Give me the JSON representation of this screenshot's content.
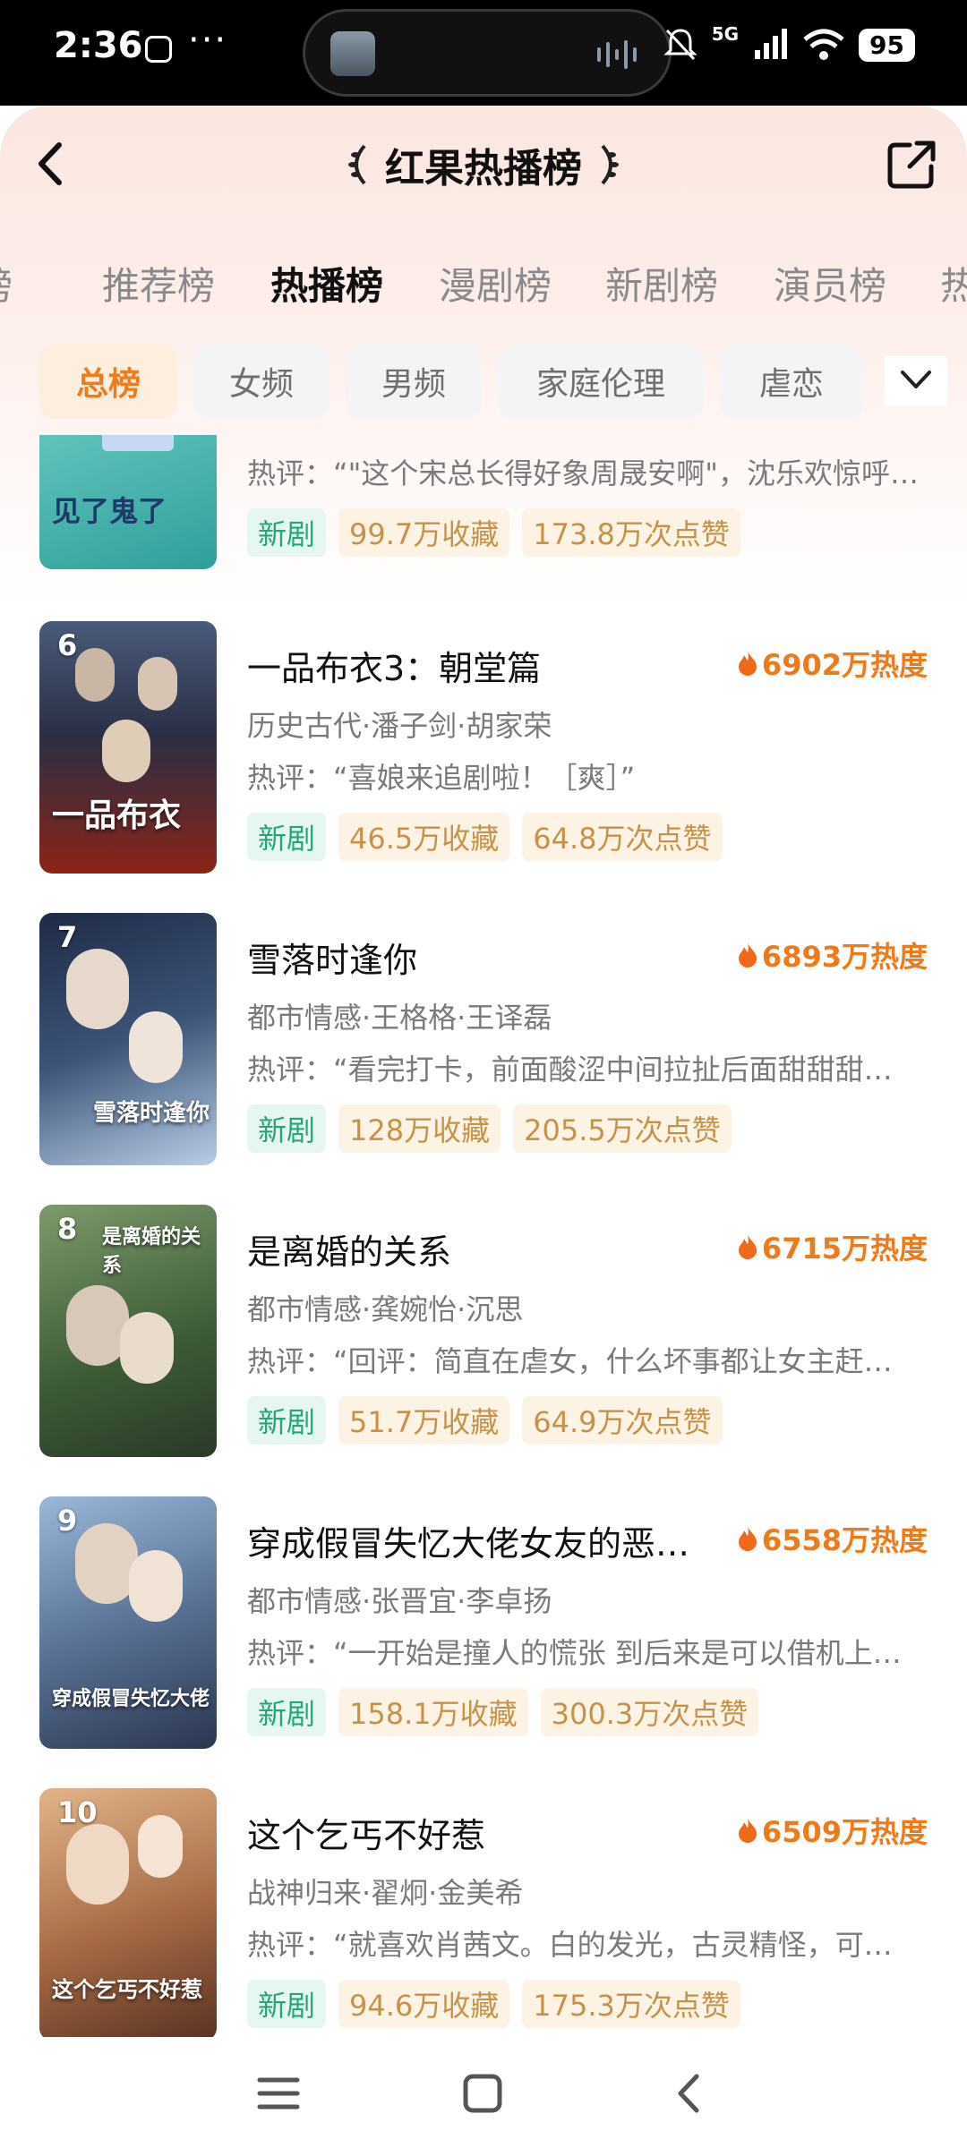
{
  "status_bar": {
    "time": "2:36",
    "more": "···",
    "network": "5G",
    "battery": "95"
  },
  "header": {
    "title": "红果热播榜"
  },
  "tabs": [
    {
      "label": "榜"
    },
    {
      "label": "推荐榜"
    },
    {
      "label": "热播榜"
    },
    {
      "label": "漫剧榜"
    },
    {
      "label": "新剧榜"
    },
    {
      "label": "演员榜"
    },
    {
      "label": "热"
    }
  ],
  "chips": [
    {
      "label": "总榜"
    },
    {
      "label": "女频"
    },
    {
      "label": "男频"
    },
    {
      "label": "家庭伦理"
    },
    {
      "label": "虐恋"
    }
  ],
  "items": [
    {
      "rank": "",
      "name": "",
      "heat": "",
      "meta": "",
      "review": "热评：“\"这个宋总长得好象周晟安啊\"，沈乐欢惊呼…",
      "tag_new": "新剧",
      "favorites": "99.7万收藏",
      "likes": "173.8万次点赞",
      "poster_text": "见了鬼了",
      "poster_colors": [
        "#5fc9c0",
        "#2e9f9a"
      ]
    },
    {
      "rank": "6",
      "name": "一品布衣3：朝堂篇",
      "heat": "6902万热度",
      "meta": "历史古代·潘子剑·胡家荣",
      "review": "热评：“喜娘来追剧啦！［爽］”",
      "tag_new": "新剧",
      "favorites": "46.5万收藏",
      "likes": "64.8万次点赞",
      "poster_text": "一品布衣",
      "poster_colors": [
        "#3a4a6a",
        "#8a2a1e"
      ]
    },
    {
      "rank": "7",
      "name": "雪落时逢你",
      "heat": "6893万热度",
      "meta": "都市情感·王格格·王译磊",
      "review": "热评：“看完打卡，前面酸涩中间拉扯后面甜甜甜…",
      "tag_new": "新剧",
      "favorites": "128万收藏",
      "likes": "205.5万次点赞",
      "poster_text": "雪落时逢你",
      "poster_colors": [
        "#2b3a5c",
        "#a9c2e0"
      ]
    },
    {
      "rank": "8",
      "name": "是离婚的关系",
      "heat": "6715万热度",
      "meta": "都市情感·龚婉怡·沉思",
      "review": "热评：“回评：简直在虐女，什么坏事都让女主赶…",
      "tag_new": "新剧",
      "favorites": "51.7万收藏",
      "likes": "64.9万次点赞",
      "poster_text": "是离婚的关系",
      "poster_colors": [
        "#3f5a3a",
        "#8fa67c"
      ]
    },
    {
      "rank": "9",
      "name": "穿成假冒失忆大佬女友的恶…",
      "heat": "6558万热度",
      "meta": "都市情感·张晋宜·李卓扬",
      "review": "热评：“一开始是撞人的慌张 到后来是可以借机上…",
      "tag_new": "新剧",
      "favorites": "158.1万收藏",
      "likes": "300.3万次点赞",
      "poster_text": "穿成假冒失忆大佬",
      "poster_colors": [
        "#6b8fb8",
        "#2e3f5a"
      ]
    },
    {
      "rank": "10",
      "name": "这个乞丐不好惹",
      "heat": "6509万热度",
      "meta": "战神归来·翟炯·金美希",
      "review": "热评：“就喜欢肖茜文。白的发光，古灵精怪，可…",
      "tag_new": "新剧",
      "favorites": "94.6万收藏",
      "likes": "175.3万次点赞",
      "poster_text": "这个乞丐不好惹",
      "poster_colors": [
        "#c98a5a",
        "#6b3a2a"
      ]
    }
  ],
  "colors": {
    "accent": "#ee7a1a",
    "new_tag": "#25a57a",
    "fav_tag": "#c7914a"
  },
  "icons": {
    "back": "chevron-left-icon",
    "share": "share-icon",
    "heat": "flame-icon",
    "more": "chevron-down-icon",
    "nav_menu": "menu-icon",
    "nav_home": "home-square-icon",
    "nav_back": "back-icon"
  }
}
